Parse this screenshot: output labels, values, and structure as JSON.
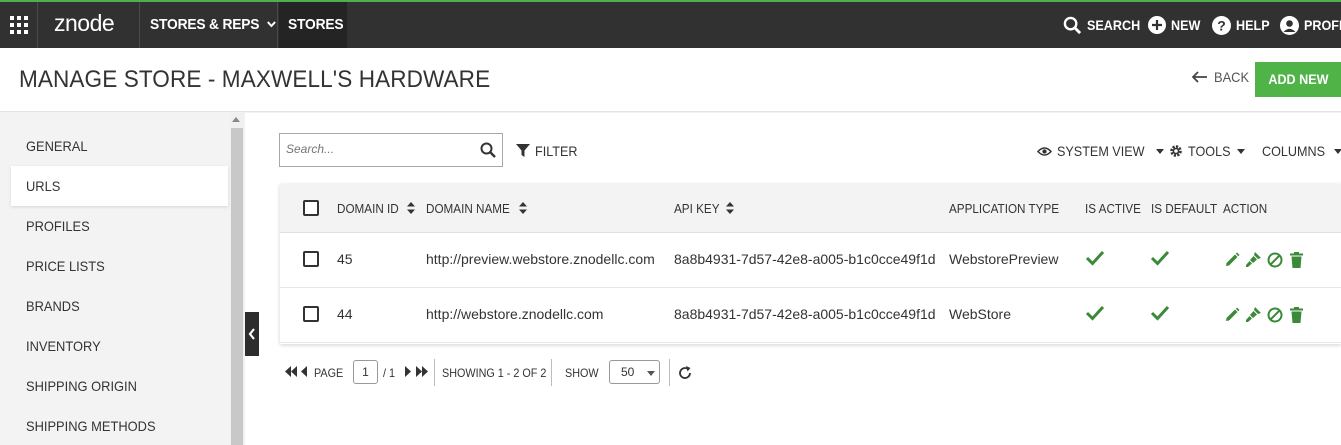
{
  "topbar": {
    "logo": "znode",
    "nav": [
      {
        "label": "STORES & REPS"
      },
      {
        "label": "STORES"
      }
    ],
    "right": {
      "search": "SEARCH",
      "new": "NEW",
      "help": "HELP",
      "profile": "PROFI"
    },
    "accent_color": "#4caf50"
  },
  "header": {
    "title": "MANAGE STORE - MAXWELL'S HARDWARE",
    "back_label": "BACK",
    "add_new_label": "ADD NEW",
    "add_new_color": "#4fb348"
  },
  "sidebar": {
    "items": [
      {
        "label": "GENERAL"
      },
      {
        "label": "URLS",
        "active": true
      },
      {
        "label": "PROFILES"
      },
      {
        "label": "PRICE LISTS"
      },
      {
        "label": "BRANDS"
      },
      {
        "label": "INVENTORY"
      },
      {
        "label": "SHIPPING ORIGIN"
      },
      {
        "label": "SHIPPING METHODS"
      }
    ]
  },
  "toolbar": {
    "search_placeholder": "Search...",
    "filter_label": "FILTER",
    "system_view_label": "SYSTEM VIEW",
    "tools_label": "TOOLS",
    "columns_label": "COLUMNS"
  },
  "grid": {
    "columns": [
      "DOMAIN ID",
      "DOMAIN NAME",
      "API KEY",
      "APPLICATION TYPE",
      "IS ACTIVE",
      "IS DEFAULT",
      "ACTION"
    ],
    "rows": [
      {
        "domain_id": "45",
        "domain_name": "http://preview.webstore.znodellc.com",
        "api_key": "8a8b4931-7d57-42e8-a005-b1c0cce49f1d",
        "application_type": "WebstorePreview",
        "is_active": true,
        "is_default": true
      },
      {
        "domain_id": "44",
        "domain_name": "http://webstore.znodellc.com",
        "api_key": "8a8b4931-7d57-42e8-a005-b1c0cce49f1d",
        "application_type": "WebStore",
        "is_active": true,
        "is_default": true
      }
    ],
    "action_icons": [
      "edit-icon",
      "brush-icon",
      "disable-icon",
      "delete-icon"
    ],
    "check_color": "#3a8a3a"
  },
  "pager": {
    "page_label": "PAGE",
    "page_value": "1",
    "page_total": "/ 1",
    "showing_label": "SHOWING 1 - 2 OF 2",
    "show_label": "SHOW",
    "page_size": "50"
  }
}
